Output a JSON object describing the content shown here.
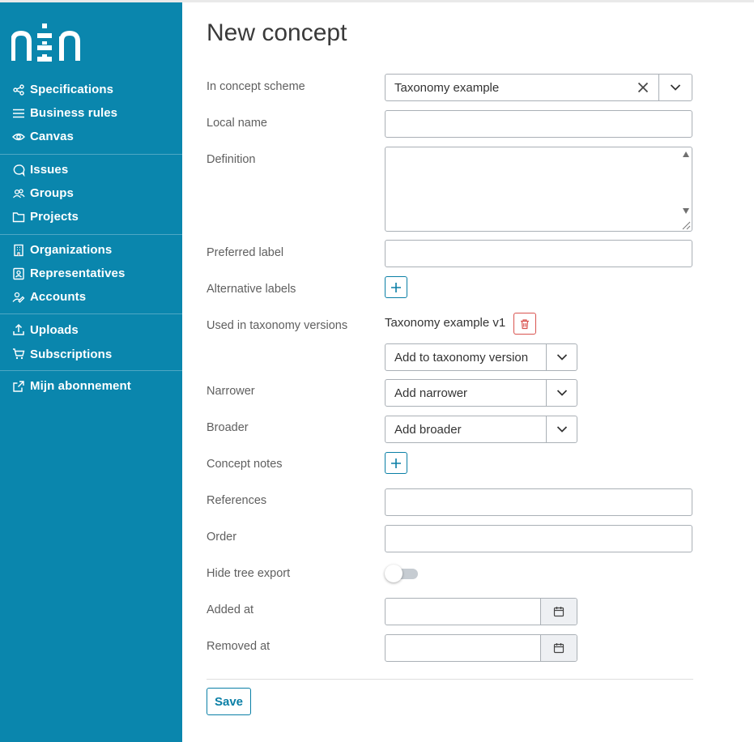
{
  "sidebar": {
    "logo_text": "nen",
    "groups": [
      [
        {
          "label": "Specifications",
          "icon": "share-nodes-icon"
        },
        {
          "label": "Business rules",
          "icon": "list-icon"
        },
        {
          "label": "Canvas",
          "icon": "eye-icon"
        }
      ],
      [
        {
          "label": "Issues",
          "icon": "chat-bubble-icon"
        },
        {
          "label": "Groups",
          "icon": "users-icon"
        },
        {
          "label": "Projects",
          "icon": "folder-icon"
        }
      ],
      [
        {
          "label": "Organizations",
          "icon": "building-icon"
        },
        {
          "label": "Representatives",
          "icon": "id-card-icon"
        },
        {
          "label": "Accounts",
          "icon": "user-edit-icon"
        }
      ],
      [
        {
          "label": "Uploads",
          "icon": "upload-icon"
        },
        {
          "label": "Subscriptions",
          "icon": "cart-icon"
        }
      ],
      [
        {
          "label": "Mijn abonnement",
          "icon": "external-link-icon"
        }
      ]
    ]
  },
  "form": {
    "title": "New concept",
    "labels": {
      "concept_scheme": "In concept scheme",
      "local_name": "Local name",
      "definition": "Definition",
      "preferred_label": "Preferred label",
      "alternative_labels": "Alternative labels",
      "used_in_versions": "Used in taxonomy versions",
      "narrower": "Narrower",
      "broader": "Broader",
      "concept_notes": "Concept notes",
      "references": "References",
      "order": "Order",
      "hide_tree_export": "Hide tree export",
      "added_at": "Added at",
      "removed_at": "Removed at"
    },
    "concept_scheme_value": "Taxonomy example",
    "taxonomy_version": "Taxonomy example v1",
    "add_taxonomy_version": "Add to taxonomy version",
    "add_narrower": "Add narrower",
    "add_broader": "Add broader",
    "hide_tree_export_on": false,
    "save_label": "Save"
  },
  "colors": {
    "sidebar_bg": "#0a86ad",
    "accent": "#0a7fa6",
    "danger": "#d9534f"
  }
}
